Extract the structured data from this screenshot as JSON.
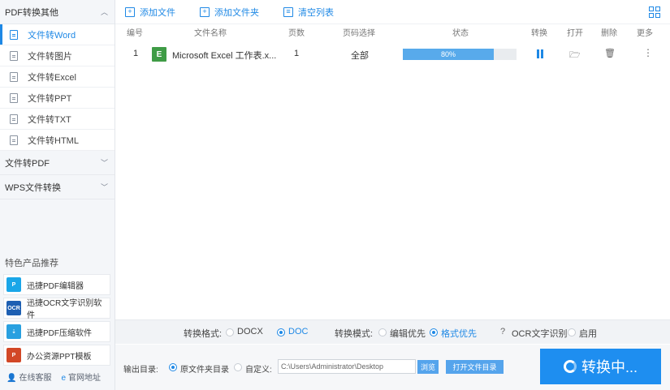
{
  "sidebar": {
    "section1": {
      "label": "PDF转换其他",
      "expanded": true
    },
    "items": [
      {
        "label": "文件转Word",
        "active": true
      },
      {
        "label": "文件转图片"
      },
      {
        "label": "文件转Excel"
      },
      {
        "label": "文件转PPT"
      },
      {
        "label": "文件转TXT"
      },
      {
        "label": "文件转HTML"
      }
    ],
    "section2": {
      "label": "文件转PDF"
    },
    "section3": {
      "label": "WPS文件转换"
    },
    "featured_title": "特色产品推荐",
    "products": [
      {
        "label": "迅捷PDF编辑器",
        "icon": "pdf-editor-icon",
        "color": "#1aa6e8"
      },
      {
        "label": "迅捷OCR文字识别软件",
        "icon": "ocr-icon",
        "color": "#1d5fb2"
      },
      {
        "label": "迅捷PDF压缩软件",
        "icon": "compress-icon",
        "color": "#28a0e0"
      },
      {
        "label": "办公资源PPT模板",
        "icon": "ppt-template-icon",
        "color": "#d24726"
      }
    ],
    "footer": {
      "service": "在线客服",
      "website": "官网地址"
    }
  },
  "toolbar": {
    "add_file": "添加文件",
    "add_folder": "添加文件夹",
    "clear_list": "清空列表"
  },
  "table": {
    "headers": {
      "num": "编号",
      "name": "文件名称",
      "pages": "页数",
      "page_select": "页码选择",
      "status": "状态",
      "convert": "转换",
      "open": "打开",
      "delete": "删除",
      "more": "更多"
    },
    "rows": [
      {
        "num": "1",
        "icon_letter": "E",
        "name": "Microsoft Excel 工作表.x...",
        "pages": "1",
        "page_select": "全部",
        "progress": 80,
        "progress_label": "80%"
      }
    ]
  },
  "options": {
    "format_label": "转换格式:",
    "format_docx": "DOCX",
    "format_doc": "DOC",
    "mode_label": "转换模式:",
    "mode_edit": "编辑优先",
    "mode_format": "格式优先",
    "ocr_label": "OCR文字识别",
    "ocr_enable": "启用"
  },
  "output": {
    "label": "输出目录:",
    "original": "原文件夹目录",
    "custom": "自定义:",
    "path": "C:\\Users\\Administrator\\Desktop",
    "browse": "浏览",
    "open_dir": "打开文件目录",
    "convert_button": "转换中..."
  },
  "colors": {
    "accent": "#1e88e5",
    "excel_green": "#3f9c46",
    "progress": "#58aaeb"
  }
}
